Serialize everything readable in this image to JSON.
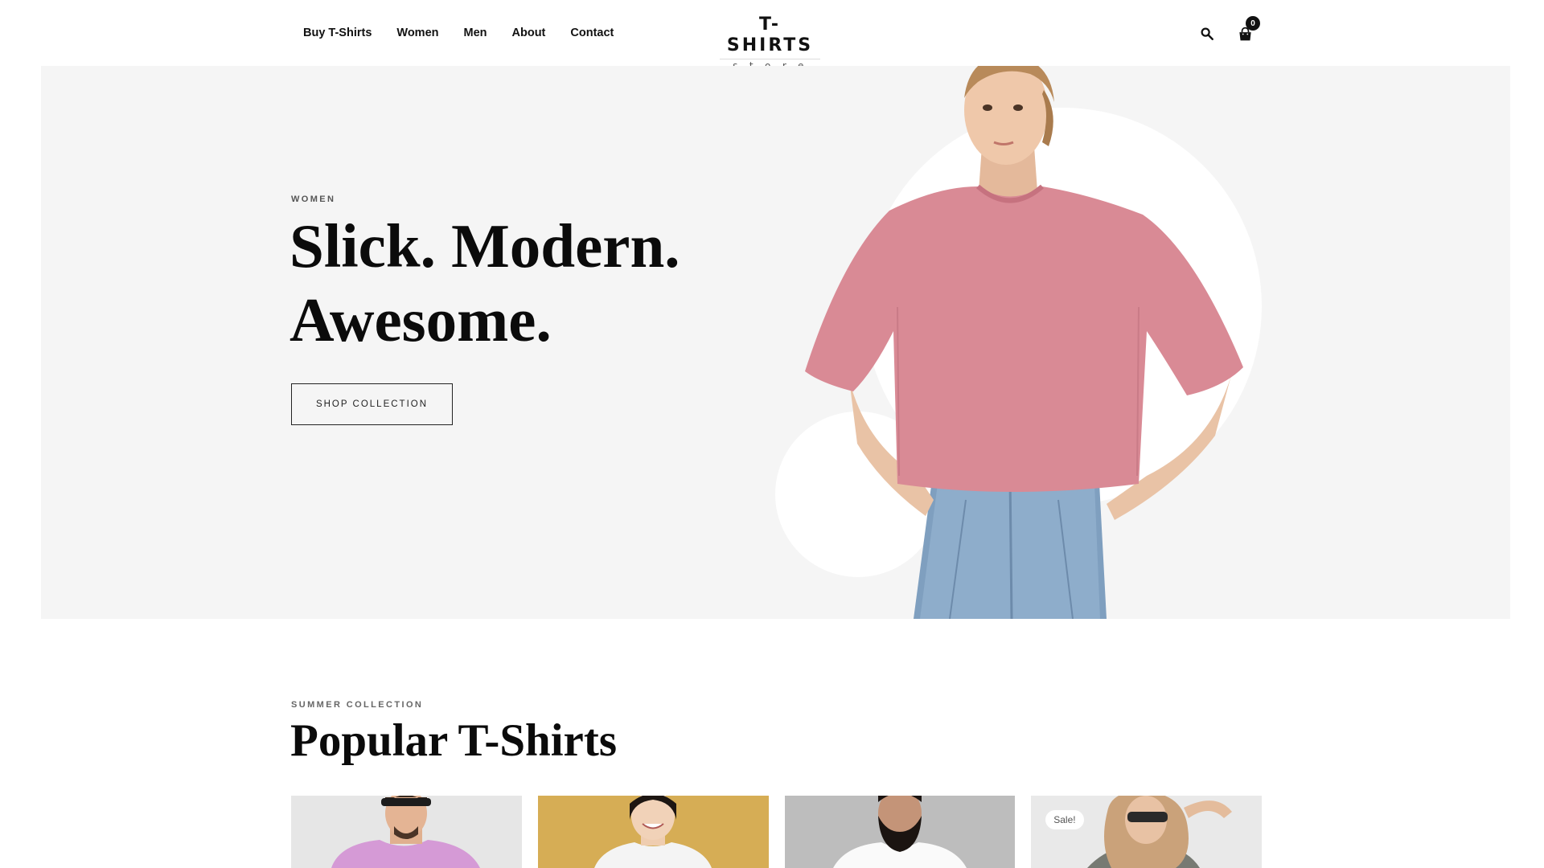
{
  "nav": {
    "items": [
      "Buy T-Shirts",
      "Women",
      "Men",
      "About",
      "Contact"
    ]
  },
  "logo": {
    "main": "T-SHIRTS",
    "sub": "store"
  },
  "header": {
    "search_icon": "search-icon",
    "cart_icon": "shopping-bag-icon",
    "cart_count": "0"
  },
  "hero": {
    "eyebrow": "WOMEN",
    "title_line1": "Slick. Modern.",
    "title_line2": "Awesome.",
    "cta": "SHOP COLLECTION",
    "background_color": "#f5f5f5",
    "shirt_color": "#d98a95"
  },
  "popular": {
    "eyebrow": "SUMMER COLLECTION",
    "title": "Popular T-Shirts",
    "products": [
      {
        "image": "man-in-pink-tshirt-with-sunglasses"
      },
      {
        "image": "woman-in-white-tshirt-yellow-background"
      },
      {
        "image": "bearded-man-in-white-tshirt"
      },
      {
        "image": "woman-in-grey-tshirt-with-sunglasses",
        "badge": "Sale!"
      }
    ]
  }
}
